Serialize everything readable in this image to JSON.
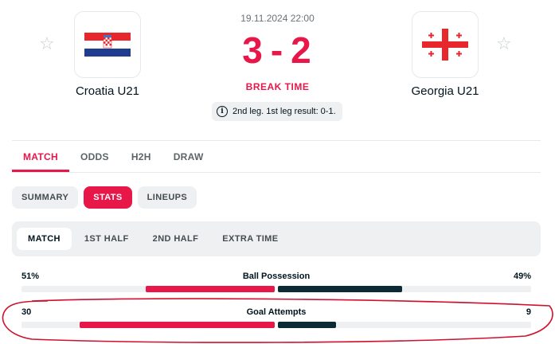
{
  "match": {
    "date": "19.11.2024 22:00",
    "home_score": "3",
    "away_score": "2",
    "separator": "-",
    "status": "BREAK TIME",
    "info": "2nd leg. 1st leg result: 0-1."
  },
  "home": {
    "name": "Croatia U21",
    "flag": "croatia-flag"
  },
  "away": {
    "name": "Georgia U21",
    "flag": "georgia-flag"
  },
  "tabs": [
    "MATCH",
    "ODDS",
    "H2H",
    "DRAW"
  ],
  "active_tab": "MATCH",
  "sub_tabs": [
    "SUMMARY",
    "STATS",
    "LINEUPS"
  ],
  "active_sub_tab": "STATS",
  "periods": [
    "MATCH",
    "1ST HALF",
    "2ND HALF",
    "EXTRA TIME"
  ],
  "active_period": "MATCH",
  "stats": [
    {
      "label": "Ball Possession",
      "home": "51%",
      "away": "49%",
      "home_share": 0.51,
      "away_share": 0.49
    },
    {
      "label": "Goal Attempts",
      "home": "30",
      "away": "9",
      "home_share": 0.77,
      "away_share": 0.23
    }
  ],
  "colors": {
    "accent": "#e8174a",
    "dark": "#0b2a33",
    "annotation": "#d0102c"
  }
}
